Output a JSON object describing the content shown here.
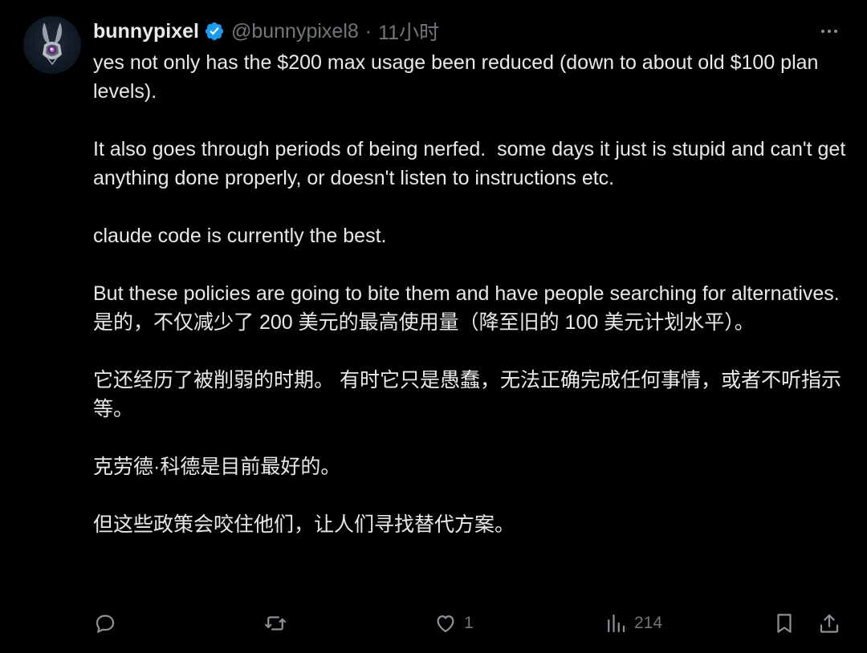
{
  "tweet": {
    "display_name": "bunnypixel",
    "handle": "@bunnypixel8",
    "separator": "·",
    "time": "11小时",
    "paragraphs_en": [
      "yes not only has the $200 max usage been reduced (down to about old $100 plan levels).",
      "It also goes through periods of being nerfed.  some days it just is stupid and can't get anything done properly, or doesn't listen to instructions etc.",
      "claude code is currently the best.",
      "But these policies are going to bite them and have people searching for alternatives."
    ],
    "paragraphs_zh": [
      "是的，不仅减少了 200 美元的最高使用量（降至旧的 100 美元计划水平）。",
      "它还经历了被削弱的时期。 有时它只是愚蠢，无法正确完成任何事情，或者不听指示等。",
      "克劳德·科德是目前最好的。",
      "但这些政策会咬住他们，让人们寻找替代方案。"
    ],
    "actions": {
      "reply_count": "",
      "retweet_count": "",
      "like_count": "1",
      "views_count": "214"
    }
  },
  "icons": {
    "verified": "verified-badge-icon",
    "more": "more-dots-icon",
    "reply": "reply-icon",
    "retweet": "retweet-icon",
    "like": "heart-icon",
    "views": "views-bar-chart-icon",
    "bookmark": "bookmark-icon",
    "share": "share-icon"
  },
  "colors": {
    "background": "#000000",
    "text_primary": "#e7e9ea",
    "text_secondary": "#71767b",
    "verified_blue": "#1d9bf0"
  }
}
